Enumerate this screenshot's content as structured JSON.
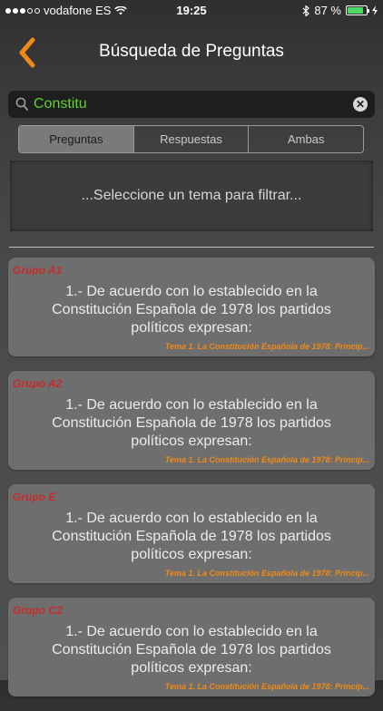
{
  "status_bar": {
    "carrier": "vodafone ES",
    "time": "19:25",
    "battery": "87 %",
    "battery_level": 0.87,
    "signal_dots": 3,
    "signal_total": 5
  },
  "nav": {
    "back_icon": "chevron-left-icon",
    "title": "Búsqueda de Preguntas",
    "accent": "#f08a16"
  },
  "search": {
    "value": "Constitu",
    "text_color": "#5fd32e"
  },
  "segments": [
    {
      "label": "Preguntas",
      "active": true
    },
    {
      "label": "Respuestas",
      "active": false
    },
    {
      "label": "Ambas",
      "active": false
    }
  ],
  "filter": {
    "prompt": "...Seleccione un tema para filtrar..."
  },
  "results": [
    {
      "grupo": "Grupo A1",
      "question": "1.-  De acuerdo con lo establecido en la Constitución Española de 1978 los partidos políticos expresan:",
      "tema": "Tema 1. La Constitución Española de 1978: Princip..."
    },
    {
      "grupo": "Grupo A2",
      "question": "1.-  De acuerdo con lo establecido en la Constitución Española de 1978 los partidos políticos expresan:",
      "tema": "Tema 1. La Constitución Española de 1978: Princip..."
    },
    {
      "grupo": "Grupo E",
      "question": "1.-  De acuerdo con lo establecido en la Constitución Española de 1978 los partidos políticos expresan:",
      "tema": "Tema 1. La Constitución Española de 1978: Princip..."
    },
    {
      "grupo": "Grupo C2",
      "question": "1.-  De acuerdo con lo establecido en la Constitución Española de 1978 los partidos políticos expresan:",
      "tema": "Tema 1. La Constitución Española de 1978: Princip..."
    }
  ]
}
